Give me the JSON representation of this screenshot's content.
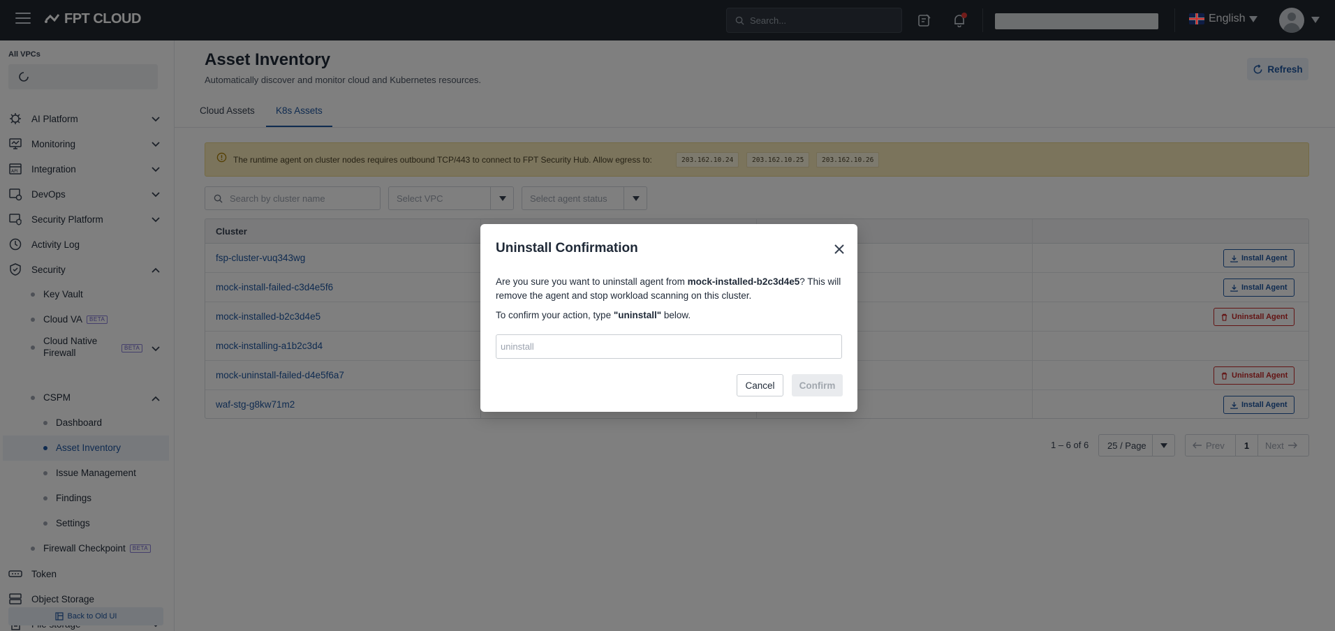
{
  "topbar": {
    "brand": "FPT CLOUD",
    "search_placeholder": "Search...",
    "language": "English"
  },
  "sidebar": {
    "vpc_label": "All VPCs",
    "items": [
      {
        "label": "AI Platform",
        "icon": "ai-platform-icon"
      },
      {
        "label": "Monitoring",
        "icon": "monitor-icon"
      },
      {
        "label": "Integration",
        "icon": "api-icon"
      },
      {
        "label": "DevOps",
        "icon": "devops-icon"
      },
      {
        "label": "Security Platform",
        "icon": "security-platform-icon"
      },
      {
        "label": "Activity Log",
        "icon": "clock-icon"
      },
      {
        "label": "Security",
        "icon": "shield-check-icon"
      }
    ],
    "security_sub": [
      {
        "label": "Key Vault"
      },
      {
        "label": "Cloud VA",
        "badge": "BETA"
      },
      {
        "label": "Cloud Native Firewall",
        "badge": "BETA"
      },
      {
        "label": "CSPM"
      }
    ],
    "cspm_sub": [
      {
        "label": "Dashboard"
      },
      {
        "label": "Asset Inventory"
      },
      {
        "label": "Issue Management"
      },
      {
        "label": "Findings"
      },
      {
        "label": "Settings"
      }
    ],
    "firewall_checkpoint": {
      "label": "Firewall Checkpoint",
      "badge": "BETA"
    },
    "bottom_items": [
      {
        "label": "Token",
        "icon": "token-icon"
      },
      {
        "label": "Object Storage",
        "icon": "storage-icon"
      },
      {
        "label": "File storage",
        "icon": "file-icon"
      }
    ],
    "back_old": "Back to Old UI"
  },
  "main": {
    "title": "Asset Inventory",
    "subtitle": "Automatically discover and monitor cloud and Kubernetes resources.",
    "refresh_label": "Refresh",
    "tabs": [
      {
        "label": "Cloud Assets",
        "active": false
      },
      {
        "label": "K8s Assets",
        "active": true
      }
    ],
    "alert": {
      "text": "The runtime agent on cluster nodes requires outbound TCP/443 to connect to FPT Security Hub. Allow egress to:",
      "ips": [
        "203.162.10.24",
        "203.162.10.25",
        "203.162.10.26"
      ]
    },
    "filters": {
      "search_placeholder": "Search by cluster name",
      "vpc_placeholder": "Select VPC",
      "status_placeholder": "Select agent status"
    },
    "table": {
      "header_cluster": "Cluster",
      "rows": [
        {
          "name": "fsp-cluster-vuq343wg",
          "action": "Install Agent"
        },
        {
          "name": "mock-install-failed-c3d4e5f6",
          "action": "Install Agent"
        },
        {
          "name": "mock-installed-b2c3d4e5",
          "action": "Uninstall Agent"
        },
        {
          "name": "mock-installing-a1b2c3d4",
          "action": ""
        },
        {
          "name": "mock-uninstall-failed-d4e5f6a7",
          "action": "Uninstall Agent"
        },
        {
          "name": "waf-stg-g8kw71m2",
          "action": "Install Agent"
        }
      ]
    },
    "pagination": {
      "info": "1 – 6 of 6",
      "page_size": "25 / Page",
      "prev": "Prev",
      "current": "1",
      "next": "Next"
    }
  },
  "modal": {
    "title": "Uninstall Confirmation",
    "body_pre": "Are you sure you want to uninstall agent from ",
    "body_cluster": "mock-installed-b2c3d4e5",
    "body_post": "? This will remove the agent and stop workload scanning on this cluster.",
    "confirm_pre": "To confirm your action, type ",
    "confirm_word": "\"uninstall\"",
    "confirm_post": " below.",
    "input_placeholder": "uninstall",
    "cancel_label": "Cancel",
    "confirm_label": "Confirm"
  }
}
